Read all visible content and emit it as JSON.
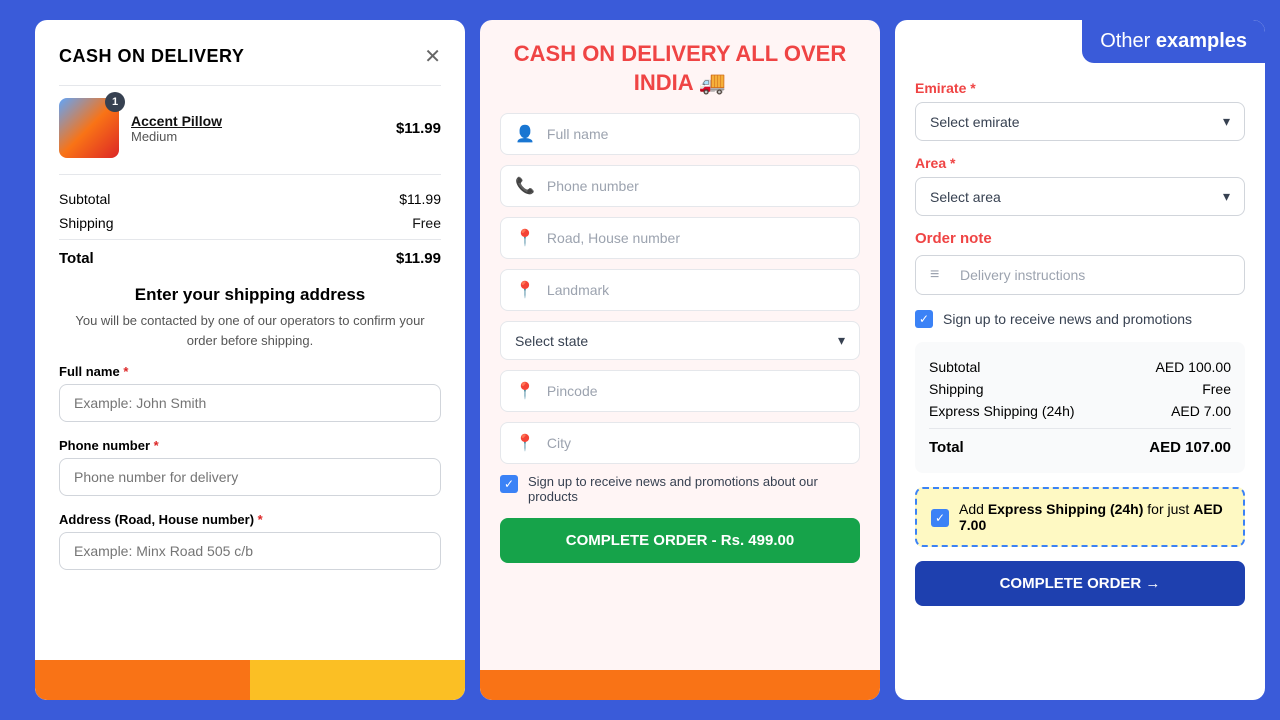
{
  "badge": {
    "text_part1": "Other ",
    "text_part2": "examples"
  },
  "left_panel": {
    "title": "CASH ON DELIVERY",
    "product": {
      "name": "Accent Pillow",
      "variant": "Medium",
      "price": "$11.99",
      "count": "1"
    },
    "subtotal_label": "Subtotal",
    "subtotal_value": "$11.99",
    "shipping_label": "Shipping",
    "shipping_value": "Free",
    "total_label": "Total",
    "total_value": "$11.99",
    "shipping_heading": "Enter your shipping address",
    "shipping_sub": "You will be contacted by one of our operators to confirm your order before shipping.",
    "form": {
      "fullname_label": "Full name",
      "fullname_placeholder": "Example: John Smith",
      "phone_label": "Phone number",
      "phone_placeholder": "Phone number for delivery",
      "address_label": "Address (Road, House number)",
      "address_placeholder": "Example: Minx Road 505 c/b"
    }
  },
  "mid_panel": {
    "title": "CASH ON DELIVERY ALL OVER INDIA 🚚",
    "fullname_placeholder": "Full name",
    "phone_placeholder": "Phone number",
    "road_placeholder": "Road, House number",
    "landmark_placeholder": "Landmark",
    "state_placeholder": "Select state",
    "pincode_placeholder": "Pincode",
    "city_placeholder": "City",
    "checkbox_label": "Sign up to receive news and promotions about our products",
    "complete_btn": "COMPLETE ORDER - Rs. 499.00"
  },
  "right_panel": {
    "emirate_label": "Emirate",
    "emirate_required": "*",
    "emirate_placeholder": "Select emirate",
    "area_label": "Area",
    "area_required": "*",
    "area_placeholder": "Select area",
    "order_note_label": "Order note",
    "delivery_placeholder": "Delivery instructions",
    "checkbox_label": "Sign up to receive news and promotions",
    "subtotal_label": "Subtotal",
    "subtotal_value": "AED 100.00",
    "shipping_label": "Shipping",
    "shipping_value": "Free",
    "express_label": "Express Shipping (24h)",
    "express_value": "AED 7.00",
    "total_label": "Total",
    "total_value": "AED 107.00",
    "express_badge_text1": "Add ",
    "express_badge_bold": "Express Shipping (24h)",
    "express_badge_text2": " for just ",
    "express_badge_price": "AED 7.00",
    "complete_btn": "COMPLETE ORDER →"
  }
}
